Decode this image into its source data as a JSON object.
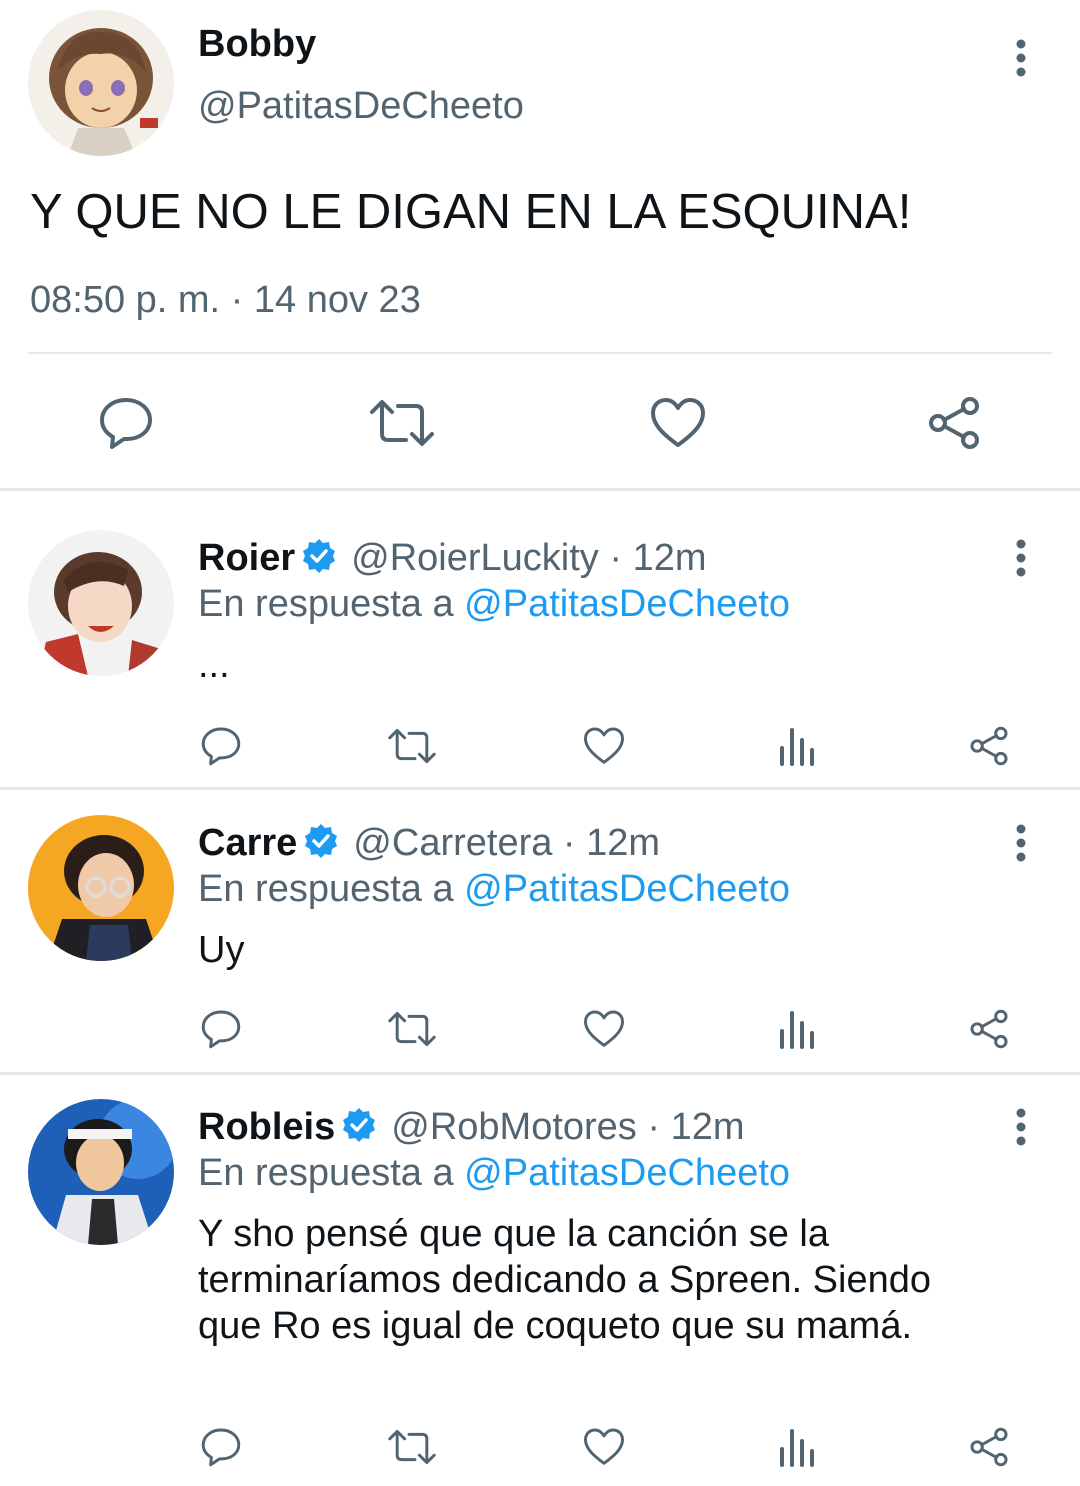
{
  "main_tweet": {
    "name": "Bobby",
    "handle": "@PatitasDeCheeto",
    "text": "Y QUE NO LE DIGAN EN LA ESQUINA!",
    "time": "08:50 p. m.",
    "separator": " · ",
    "date": "14 nov 23",
    "actions": [
      "reply-icon",
      "retweet-icon",
      "like-icon",
      "share-icon"
    ]
  },
  "replies": [
    {
      "name": "Roier",
      "verified": true,
      "handle": "@RoierLuckity",
      "dot": " · ",
      "time": "12m",
      "reply_prefix": "En respuesta a ",
      "reply_to": "@PatitasDeCheeto",
      "text": "...",
      "actions": [
        "reply-icon",
        "retweet-icon",
        "like-icon",
        "views-icon",
        "share-icon"
      ]
    },
    {
      "name": "Carre",
      "verified": true,
      "handle": "@Carretera",
      "dot": " · ",
      "time": "12m",
      "reply_prefix": "En respuesta a ",
      "reply_to": "@PatitasDeCheeto",
      "text": "Uy",
      "actions": [
        "reply-icon",
        "retweet-icon",
        "like-icon",
        "views-icon",
        "share-icon"
      ]
    },
    {
      "name": "Robleis",
      "verified": true,
      "handle": "@RobMotores",
      "dot": " · ",
      "time": "12m",
      "reply_prefix": "En respuesta a ",
      "reply_to": "@PatitasDeCheeto",
      "text": "Y sho pensé que que la canción se la terminaríamos dedicando a Spreen. Siendo que Ro es igual de coqueto que su mamá.",
      "actions": [
        "reply-icon",
        "retweet-icon",
        "like-icon",
        "views-icon",
        "share-icon"
      ]
    }
  ],
  "colors": {
    "text_primary": "#0f1419",
    "text_secondary": "#536471",
    "link": "#1d9bf0",
    "verified": "#1d9bf0",
    "divider": "#e6e9eb"
  }
}
